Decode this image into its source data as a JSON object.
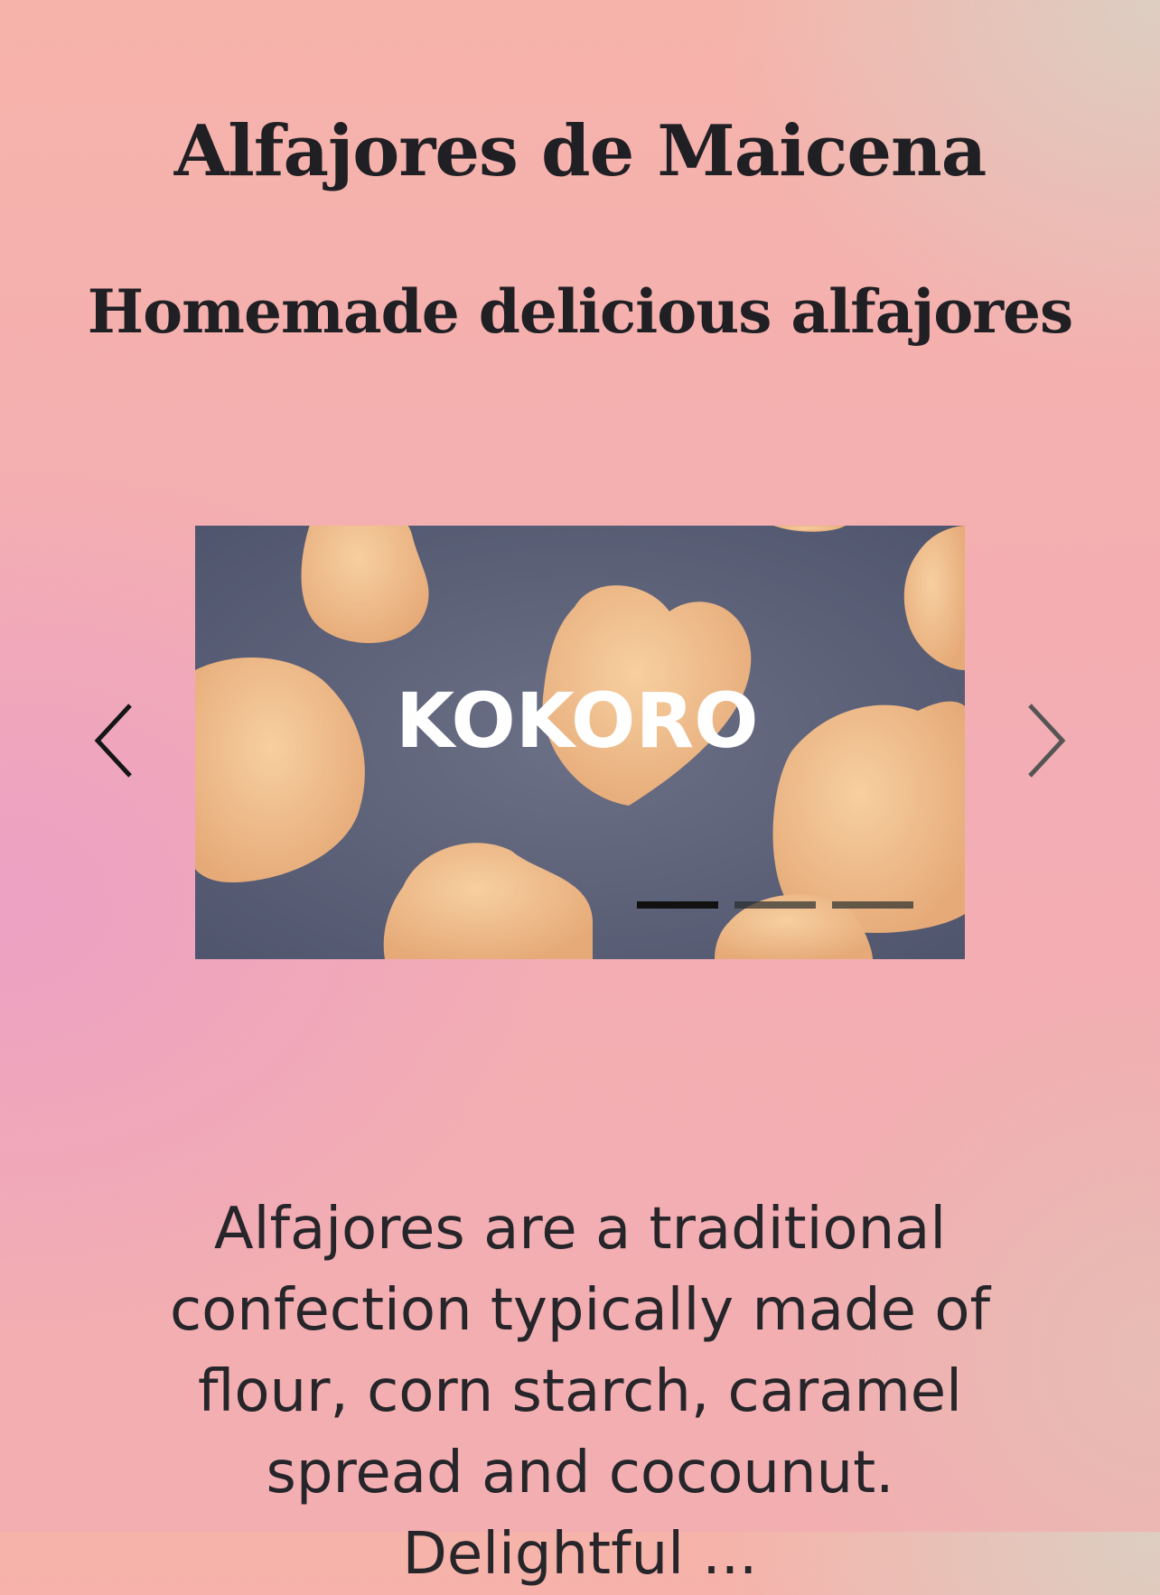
{
  "header": {
    "title": "Alfajores de Maicena",
    "subtitle": "Homemade delicious alfajores"
  },
  "carousel": {
    "prev_icon": "chevron-left-icon",
    "next_icon": "chevron-right-icon",
    "slide_logo_text": "KOKORO",
    "active_index": 0,
    "indicator_count": 3
  },
  "description": {
    "text": "Alfajores are a traditional confection typically made of flour, corn starch, caramel spread and cocounut. Delightful ..."
  },
  "colors": {
    "text": "#1f1f24",
    "indicator_active": "#111111",
    "indicator_inactive": "#3a3f3f"
  }
}
